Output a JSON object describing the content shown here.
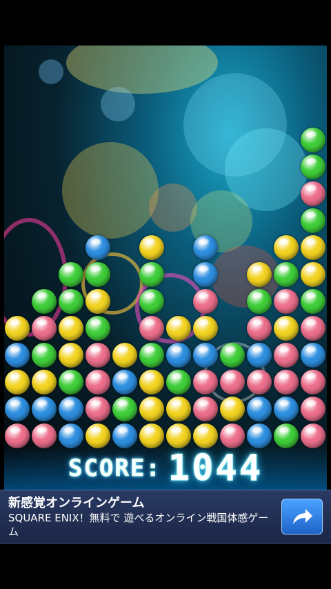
{
  "game": {
    "score_label": "SCORE:",
    "score_value": "1044",
    "colors": {
      "G": "#3fce3a",
      "Y": "#f2d321",
      "P": "#ec6f8c",
      "B": "#2e8fe0"
    },
    "grid_columns": 12,
    "grid_rows": 14,
    "columns": [
      [
        "P",
        "B",
        "Y",
        "B",
        "Y"
      ],
      [
        "P",
        "B",
        "Y",
        "G",
        "P",
        "G"
      ],
      [
        "B",
        "B",
        "G",
        "Y",
        "Y",
        "G",
        "G"
      ],
      [
        "Y",
        "P",
        "P",
        "P",
        "G",
        "Y",
        "G",
        "B"
      ],
      [
        "B",
        "G",
        "B",
        "Y"
      ],
      [
        "Y",
        "Y",
        "Y",
        "G",
        "P",
        "G",
        "G",
        "Y"
      ],
      [
        "Y",
        "Y",
        "G",
        "B",
        "Y"
      ],
      [
        "Y",
        "P",
        "P",
        "B",
        "Y",
        "P",
        "B",
        "B"
      ],
      [
        "P",
        "Y",
        "P",
        "G"
      ],
      [
        "B",
        "B",
        "P",
        "B",
        "P",
        "G",
        "Y"
      ],
      [
        "G",
        "B",
        "P",
        "P",
        "Y",
        "P",
        "G",
        "Y"
      ],
      [
        "P",
        "P",
        "P",
        "B",
        "P",
        "G",
        "Y",
        "Y",
        "G",
        "P",
        "G",
        "G"
      ]
    ]
  },
  "ad": {
    "title": "新感覚オンラインゲーム",
    "description": "SQUARE ENIX！無料で 遊べるオンライン戦国体感ゲーム",
    "button_icon": "share-arrow-icon"
  }
}
